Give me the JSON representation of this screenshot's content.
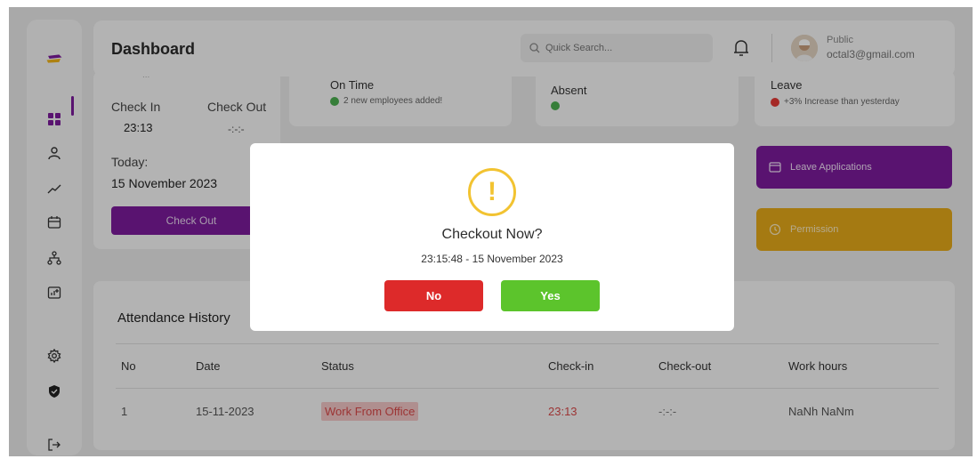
{
  "header": {
    "title": "Dashboard",
    "search_placeholder": "Quick Search...",
    "user_name": "Public",
    "user_email": "octal3@gmail.com"
  },
  "sidebar": {
    "icons": [
      "logo-icon",
      "dashboard-grid-icon",
      "user-icon",
      "trend-line-icon",
      "calendar-icon",
      "org-chart-icon",
      "report-add-icon",
      "settings-icon",
      "shield-icon",
      "logout-icon"
    ]
  },
  "checkin_card": {
    "partial_text": "...",
    "check_in_label": "Check In",
    "check_in_value": "23:13",
    "check_out_label": "Check Out",
    "check_out_value": "-:-:-",
    "today_label": "Today:",
    "date": "15 November 2023",
    "checkout_button": "Check Out"
  },
  "stat_cards": [
    {
      "label": "On Time",
      "note": "2 new employees added!",
      "dot_color": "#4caf50"
    },
    {
      "label": "Absent",
      "note": "",
      "dot_color": "#4caf50"
    },
    {
      "label": "Leave",
      "note": "+3% Increase than yesterday",
      "dot_color": "#e53935"
    }
  ],
  "actions": {
    "leave_applications": "Leave Applications",
    "permission": "Permission"
  },
  "attendance": {
    "title": "Attendance History",
    "columns": [
      "No",
      "Date",
      "Status",
      "Check-in",
      "Check-out",
      "Work hours"
    ],
    "rows": [
      {
        "no": "1",
        "date": "15-11-2023",
        "status": "Work From Office",
        "check_in": "23:13",
        "check_out": "-:-:-",
        "work_hours": "NaNh NaNm"
      }
    ]
  },
  "modal": {
    "title": "Checkout Now?",
    "subtitle": "23:15:48 - 15 November 2023",
    "no_label": "No",
    "yes_label": "Yes"
  },
  "colors": {
    "brand_purple": "#7c1b9c",
    "permission_yellow": "#e5a91a",
    "no_red": "#dd2a2a",
    "yes_green": "#5cc42c",
    "warning_yellow": "#f2c331"
  }
}
